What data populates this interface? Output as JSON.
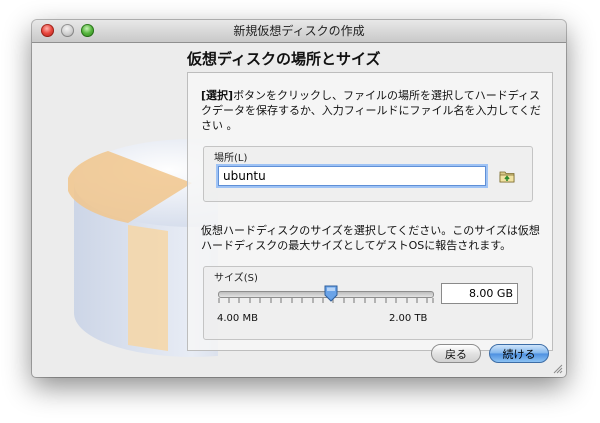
{
  "window": {
    "title": "新規仮想ディスクの作成"
  },
  "header": {
    "title": "仮想ディスクの場所とサイズ"
  },
  "intro": {
    "bold_prefix": "[選択]",
    "text": "ボタンをクリックし、ファイルの場所を選択してハードディスクデータを保存するか、入力フィールドにファイル名を入力してください 。"
  },
  "location": {
    "label": "場所(L)",
    "value": "ubuntu",
    "folder_icon": "folder-icon"
  },
  "size_help": {
    "text": "仮想ハードディスクのサイズを選択してください。このサイズは仮想ハードディスクの最大サイズとしてゲストOSに報告されます。"
  },
  "size": {
    "label": "サイズ(S)",
    "value": "8.00 GB",
    "min_label": "4.00 MB",
    "max_label": "2.00 TB",
    "slider_fraction": 0.5
  },
  "buttons": {
    "back": "戻る",
    "next": "続ける"
  },
  "colors": {
    "accent": "#4c8fe0",
    "focus_ring": "#9fc3f5"
  }
}
